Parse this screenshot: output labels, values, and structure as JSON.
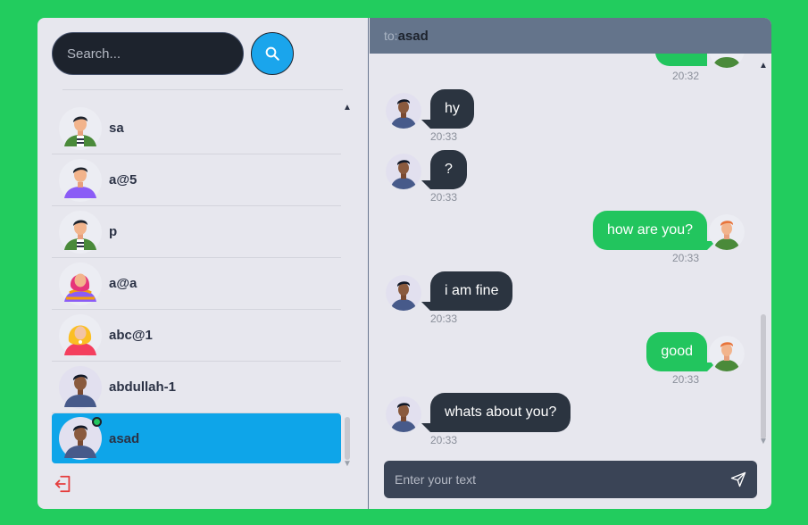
{
  "search": {
    "placeholder": "Search..."
  },
  "contacts": [
    {
      "name": "sa",
      "avatar": "avatar-man-striped-shirt"
    },
    {
      "name": "a@5",
      "avatar": "avatar-man-purple-shirt"
    },
    {
      "name": "p",
      "avatar": "avatar-man-striped-shirt"
    },
    {
      "name": "a@a",
      "avatar": "avatar-woman-pink-hair"
    },
    {
      "name": "abc@1",
      "avatar": "avatar-woman-blonde"
    },
    {
      "name": "abdullah-1",
      "avatar": "avatar-man-dark"
    },
    {
      "name": "asad",
      "avatar": "avatar-man-dark",
      "active": true,
      "online": true
    }
  ],
  "chat": {
    "to_label": "to:",
    "recipient": "asad",
    "messages": [
      {
        "dir": "out",
        "text": "",
        "time": "20:32"
      },
      {
        "dir": "in",
        "text": "hy",
        "time": "20:33"
      },
      {
        "dir": "in",
        "text": "?",
        "time": "20:33"
      },
      {
        "dir": "out",
        "text": "how are you?",
        "time": "20:33"
      },
      {
        "dir": "in",
        "text": "i am fine",
        "time": "20:33"
      },
      {
        "dir": "out",
        "text": "good",
        "time": "20:33"
      },
      {
        "dir": "in",
        "text": "whats about you?",
        "time": "20:33"
      }
    ],
    "input_placeholder": "Enter your text"
  },
  "colors": {
    "background": "#22cc5e",
    "active_contact": "#0ea5e9",
    "outgoing_bubble": "#22c55e",
    "incoming_bubble": "#2b3440",
    "header": "#64748b"
  },
  "icons": {
    "search_button": "search-icon",
    "logout": "logout-icon",
    "send": "send-icon"
  }
}
